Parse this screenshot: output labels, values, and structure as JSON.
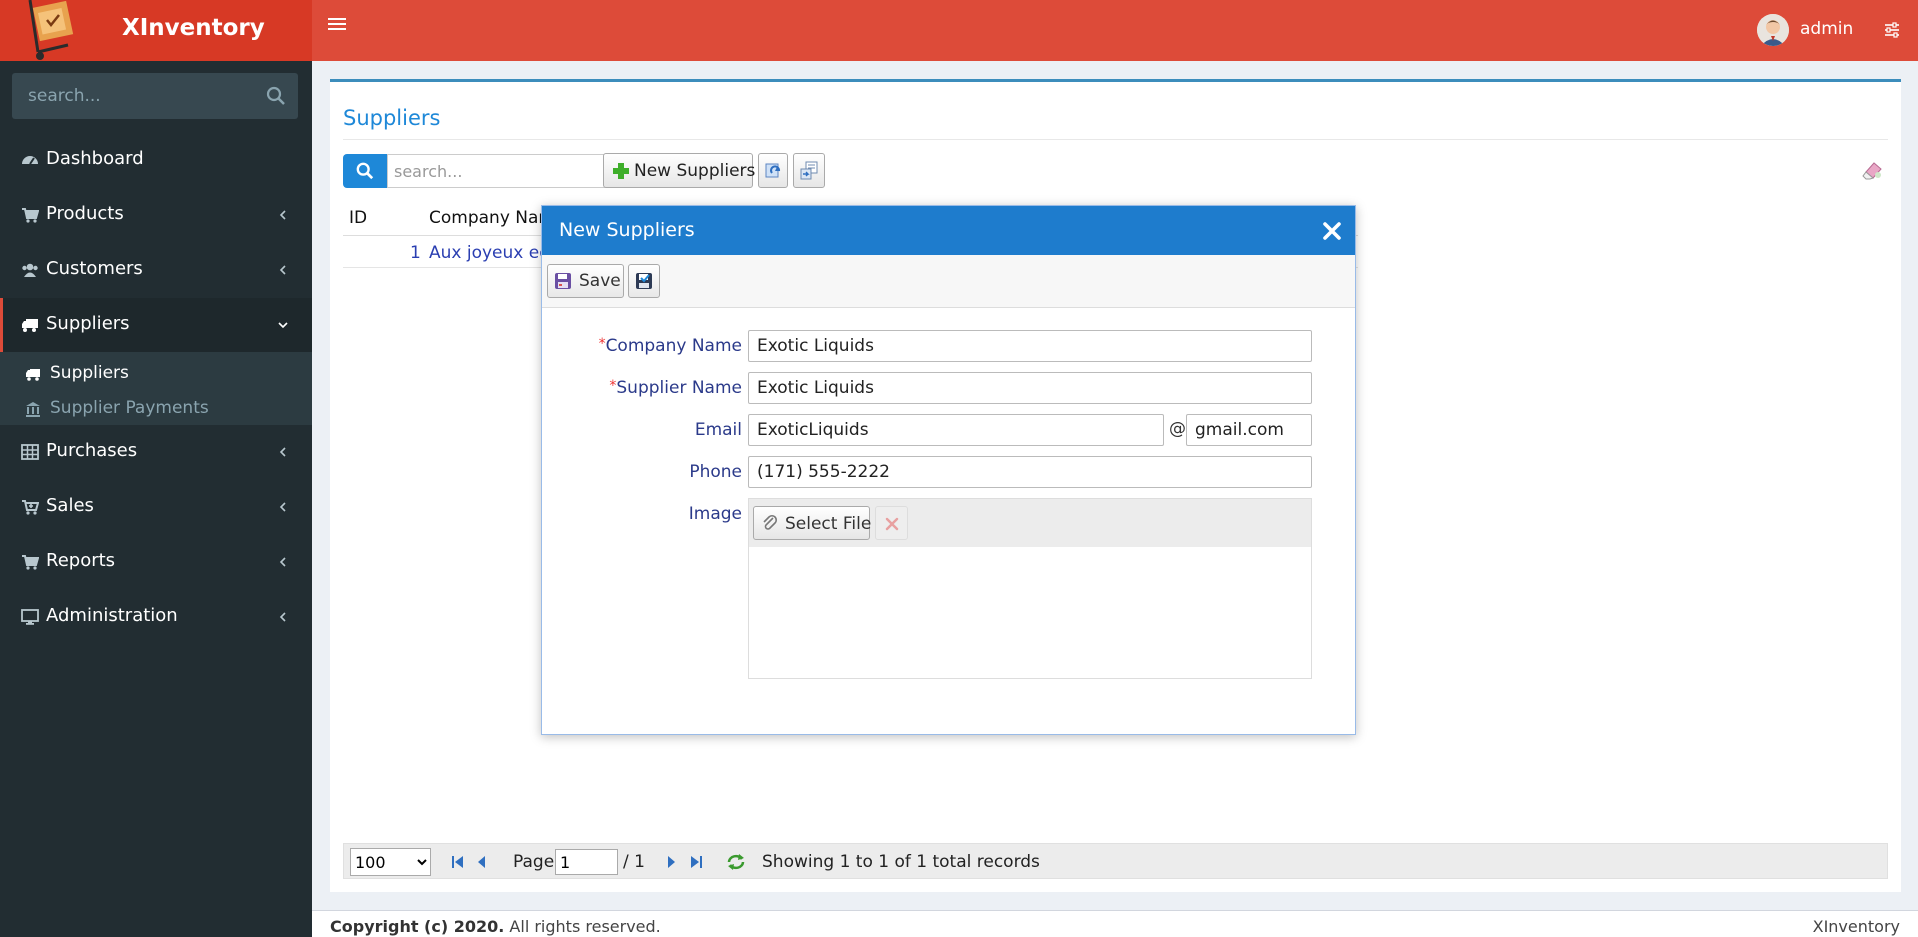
{
  "app": {
    "brand": "XInventory",
    "user": "admin"
  },
  "sidebar": {
    "search_placeholder": "search...",
    "items": [
      {
        "label": "Dashboard"
      },
      {
        "label": "Products"
      },
      {
        "label": "Customers"
      },
      {
        "label": "Suppliers"
      },
      {
        "label": "Purchases"
      },
      {
        "label": "Sales"
      },
      {
        "label": "Reports"
      },
      {
        "label": "Administration"
      }
    ],
    "submenu": [
      {
        "label": "Suppliers"
      },
      {
        "label": "Supplier Payments"
      }
    ]
  },
  "main": {
    "title": "Suppliers",
    "search_placeholder": "search...",
    "new_button": "New Suppliers",
    "columns": [
      "ID",
      "Company Nam"
    ],
    "rows": [
      {
        "id": "1",
        "company": "Aux joyeux ecc"
      }
    ],
    "pager": {
      "page_size": "100",
      "page_label": "Page",
      "page_value": "1",
      "page_total": "/ 1",
      "summary": "Showing 1 to 1 of 1 total records"
    }
  },
  "modal": {
    "title": "New Suppliers",
    "save_label": "Save",
    "fields": {
      "company_name_label": "Company Name",
      "company_name_value": "Exotic Liquids",
      "supplier_name_label": "Supplier Name",
      "supplier_name_value": "Exotic Liquids",
      "email_label": "Email",
      "email_user": "ExoticLiquids",
      "email_at": "@",
      "email_domain": "gmail.com",
      "phone_label": "Phone",
      "phone_value": "(171) 555-2222",
      "image_label": "Image",
      "select_file": "Select File",
      "required_mark": "*"
    }
  },
  "footer": {
    "copyright_bold": "Copyright (c) 2020.",
    "copyright_rest": " All rights reserved.",
    "right": "XInventory"
  },
  "colors": {
    "header": "#dd4b39",
    "sidebar": "#222d32",
    "accent": "#1e88d8",
    "modal_header": "#1e7ccd"
  }
}
